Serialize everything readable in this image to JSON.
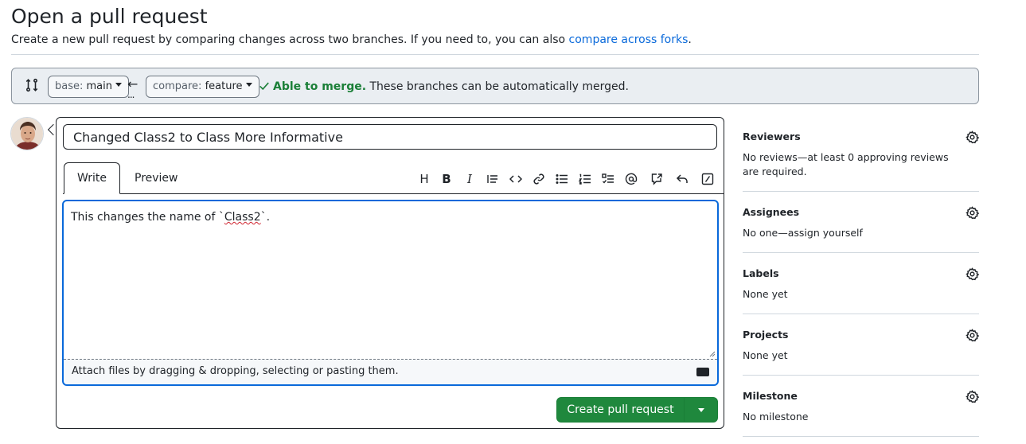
{
  "header": {
    "title": "Open a pull request",
    "subtitle_prefix": "Create a new pull request by comparing changes across two branches. If you need to, you can also ",
    "subtitle_link": "compare across forks",
    "subtitle_suffix": "."
  },
  "range": {
    "base_key": "base:",
    "base_value": "main",
    "arrow": "←",
    "ellipsis": "...",
    "compare_key": "compare:",
    "compare_value": "feature",
    "merge_ok": "Able to merge.",
    "merge_msg": " These branches can be automatically merged."
  },
  "composer": {
    "title_value": "Changed Class2 to Class More Informative",
    "tabs": [
      "Write",
      "Preview"
    ],
    "toolbar_heading": "H",
    "toolbar_bold": "B",
    "toolbar_italic": "I",
    "body_prefix": "This changes the name of `",
    "body_misspelled": "Class2",
    "body_suffix": "`.",
    "attach_text": "Attach files by dragging & dropping, selecting or pasting them.",
    "submit_label": "Create pull request"
  },
  "sidebar": {
    "reviewers_title": "Reviewers",
    "reviewers_body": "No reviews—at least 0 approving reviews are required.",
    "assignees_title": "Assignees",
    "assignees_body": "No one—assign yourself",
    "labels_title": "Labels",
    "labels_body": "None yet",
    "projects_title": "Projects",
    "projects_body": "None yet",
    "milestone_title": "Milestone",
    "milestone_body": "No milestone"
  },
  "colors": {
    "accent": "#0969da",
    "success": "#1f883d",
    "merge_ok": "#1a7f37"
  }
}
